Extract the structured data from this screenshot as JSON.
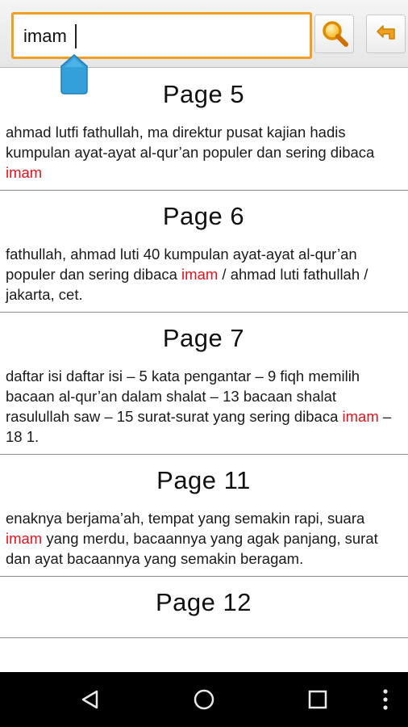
{
  "search": {
    "query": "imam"
  },
  "toolbar": {
    "search_icon": "magnifier-icon",
    "back_icon": "return-arrow-icon",
    "accent_color": "#f0a020"
  },
  "results": [
    {
      "title": "Page 5",
      "snippet_before": "ahmad lutfi fathullah, ma direktur pusat kajian hadis kumpulan ayat-ayat al-qur’an populer dan sering dibaca ",
      "highlight": "imam",
      "snippet_after": ""
    },
    {
      "title": "Page 6",
      "snippet_before": "fathullah, ahmad luti 40 kumpulan ayat-ayat al-qur’an populer dan sering dibaca ",
      "highlight": "imam",
      "snippet_after": " / ahmad luti fathullah / jakarta, cet."
    },
    {
      "title": "Page 7",
      "snippet_before": "daftar isi daftar isi – 5 kata pengantar – 9 fiqh memilih bacaan al-qur’an dalam shalat – 13 bacaan shalat rasulullah saw – 15 surat-surat yang sering dibaca ",
      "highlight": "imam",
      "snippet_after": " – 18 1."
    },
    {
      "title": "Page 11",
      "snippet_before": "enaknya berjama’ah, tempat yang semakin rapi, suara ",
      "highlight": "imam",
      "snippet_after": " yang merdu, bacaannya yang agak panjang, surat dan ayat bacaannya yang semakin beragam."
    },
    {
      "title": "Page 12",
      "snippet_before": "",
      "highlight": "",
      "snippet_after": ""
    }
  ],
  "highlight_color": "#e8101a",
  "navbar": {
    "back_icon": "nav-back-icon",
    "home_icon": "nav-home-icon",
    "recents_icon": "nav-recents-icon",
    "menu_icon": "overflow-menu-icon"
  }
}
